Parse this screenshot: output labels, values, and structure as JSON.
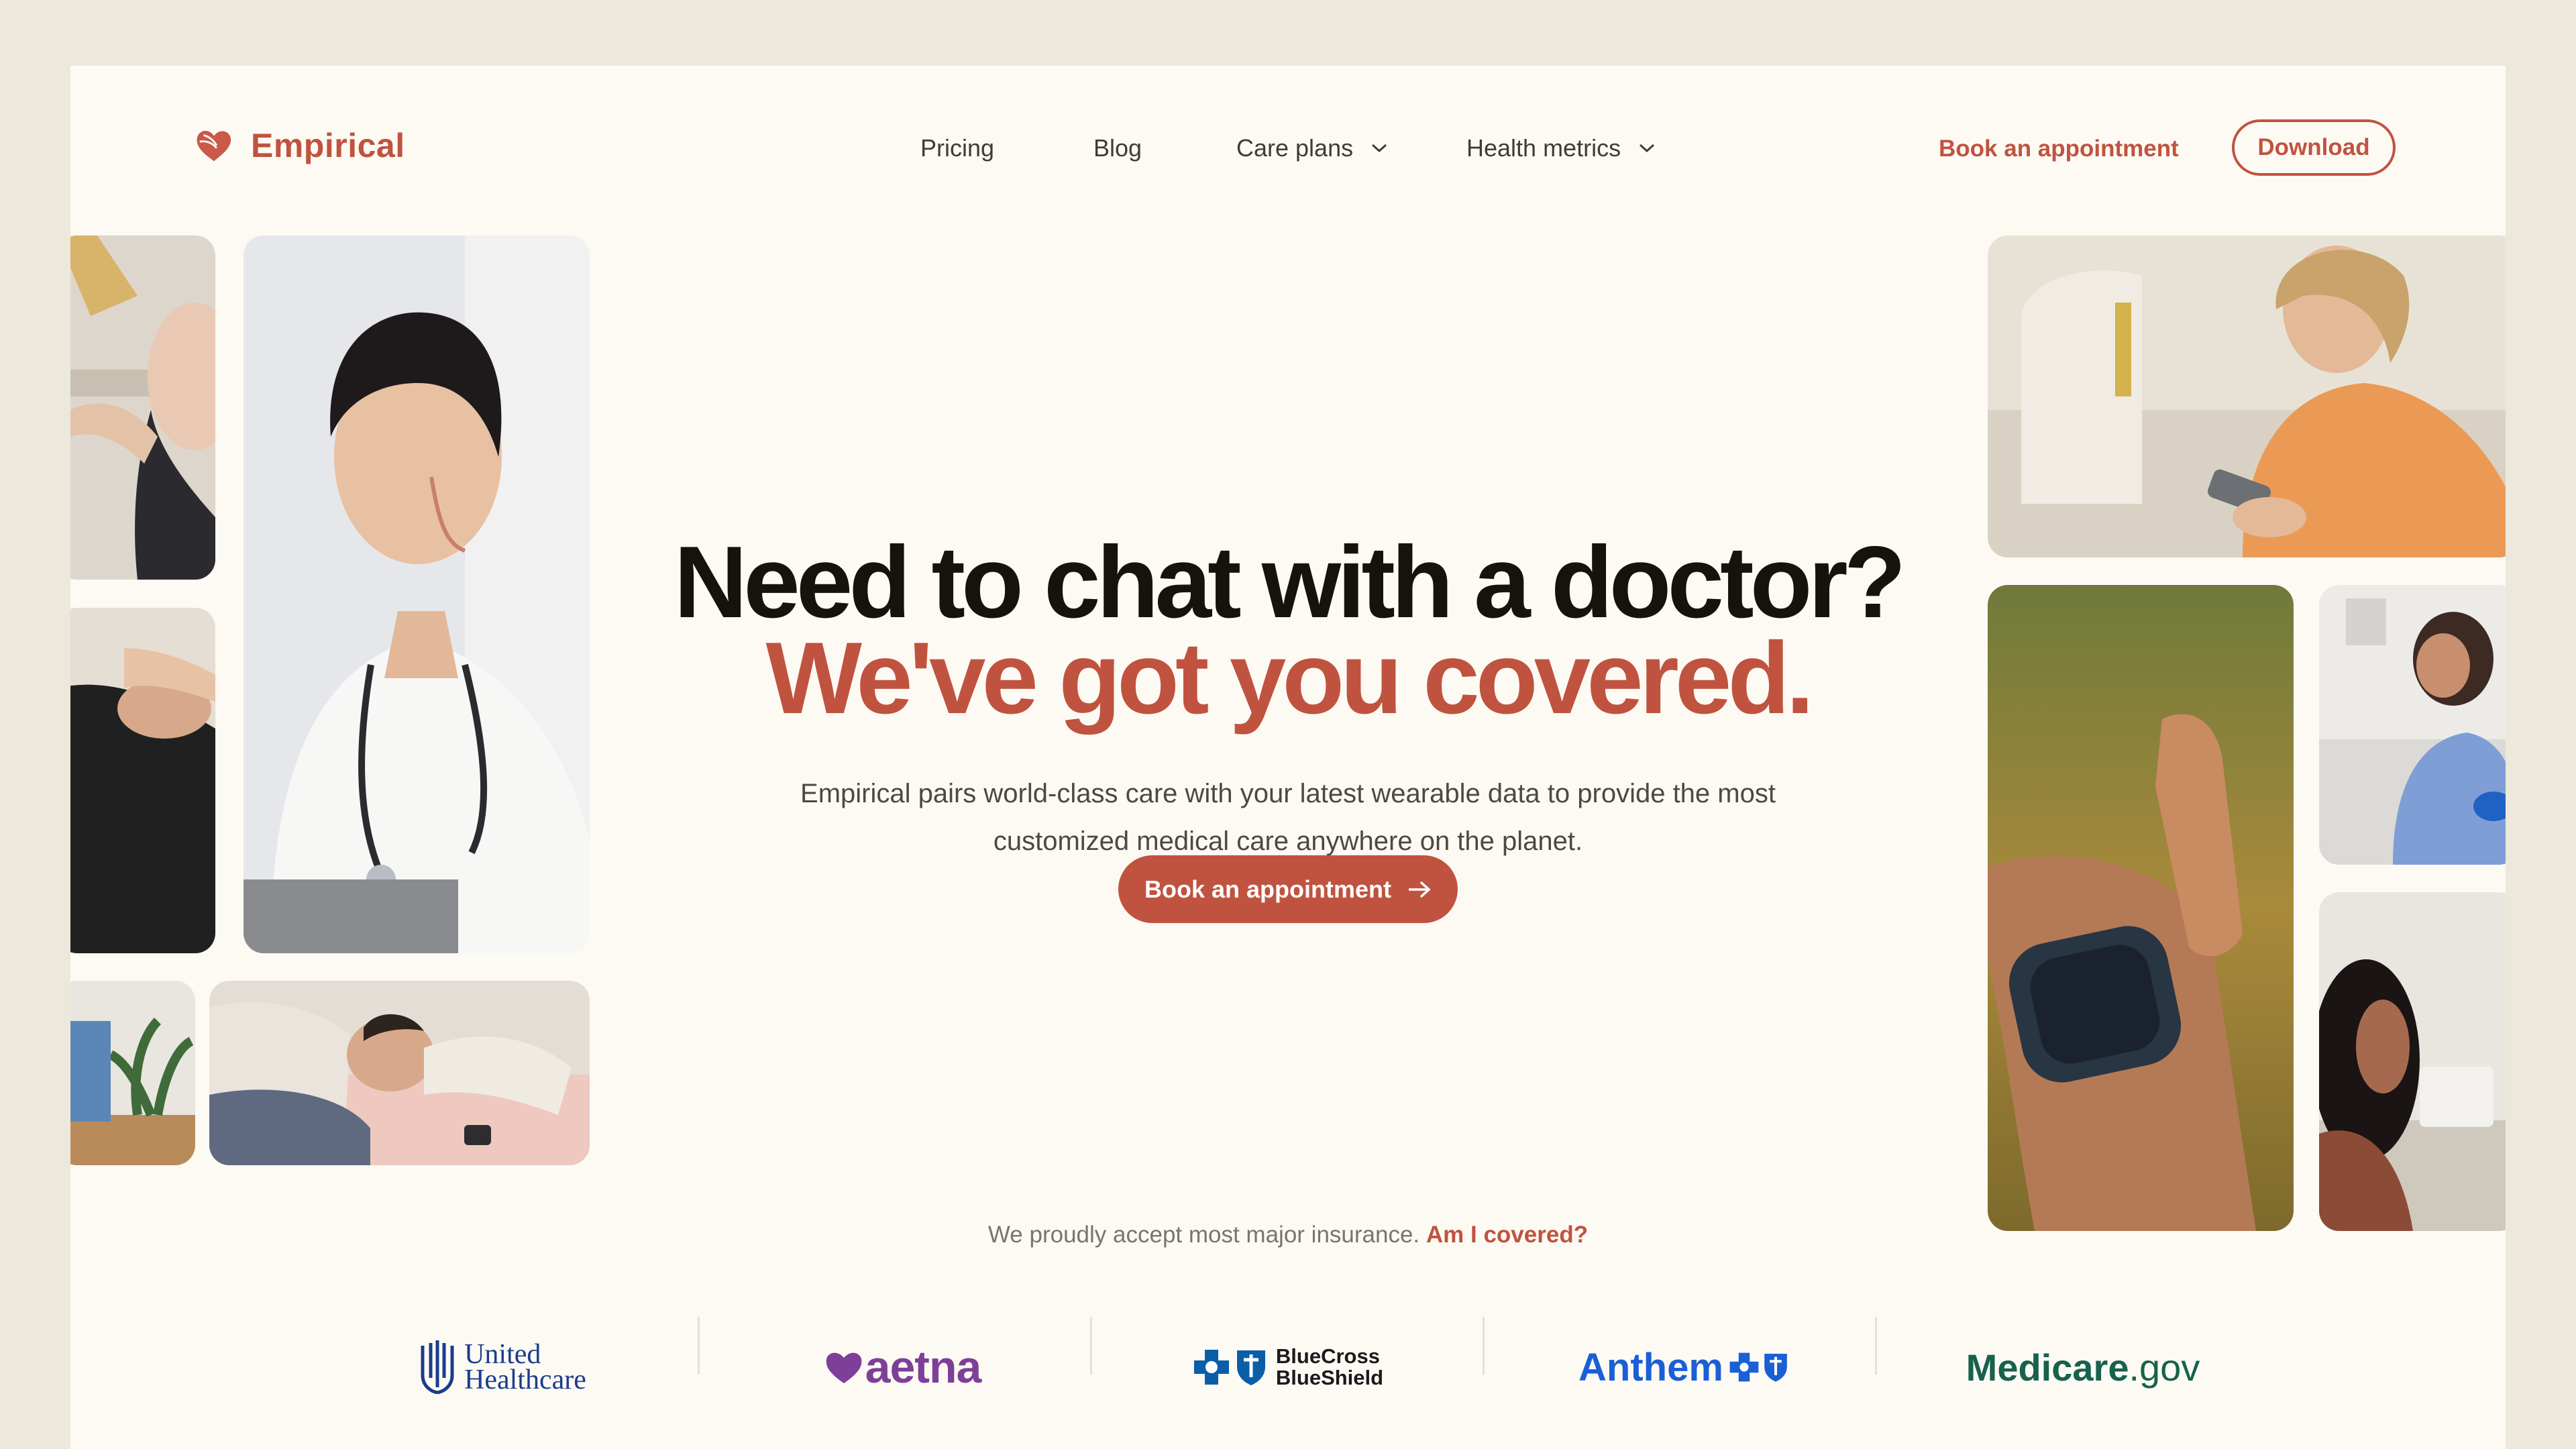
{
  "brand": {
    "name": "Empirical",
    "accent": "#c0533f"
  },
  "nav": {
    "items": [
      {
        "label": "Pricing",
        "dropdown": false
      },
      {
        "label": "Blog",
        "dropdown": false
      },
      {
        "label": "Care plans",
        "dropdown": true
      },
      {
        "label": "Health metrics",
        "dropdown": true
      }
    ],
    "book_link": "Book an appointment",
    "download": "Download"
  },
  "hero": {
    "title_line1": "Need to chat with a doctor?",
    "title_line2": "We've got you covered.",
    "subtitle": "Empirical pairs world-class care with your latest wearable data to provide the most customized medical care anywhere on the planet.",
    "cta": "Book an appointment"
  },
  "insurance": {
    "text": "We proudly accept most major insurance.",
    "link": "Am I covered?",
    "logos": [
      {
        "name": "United Healthcare",
        "line1": "United",
        "line2": "Healthcare",
        "color": "#1b3c8c"
      },
      {
        "name": "aetna",
        "color": "#7d3f98"
      },
      {
        "name": "BlueCross BlueShield",
        "line1": "BlueCross",
        "line2": "BlueShield",
        "color": "#0a5ea8"
      },
      {
        "name": "Anthem",
        "color": "#1a5fd6"
      },
      {
        "name": "Medicare.gov",
        "brand": "Medicare",
        "suffix": ".gov",
        "color": "#17614d"
      }
    ]
  },
  "photos": [
    {
      "name": "patient-photo-cropped"
    },
    {
      "name": "doctor-smiling-photo"
    },
    {
      "name": "exam-photo-cropped"
    },
    {
      "name": "clinic-plant-photo"
    },
    {
      "name": "sleeping-with-smartwatch-photo"
    },
    {
      "name": "woman-using-phone-photo"
    },
    {
      "name": "smartwatch-closeup-photo"
    },
    {
      "name": "nurse-photo"
    },
    {
      "name": "patient-lab-photo"
    }
  ]
}
